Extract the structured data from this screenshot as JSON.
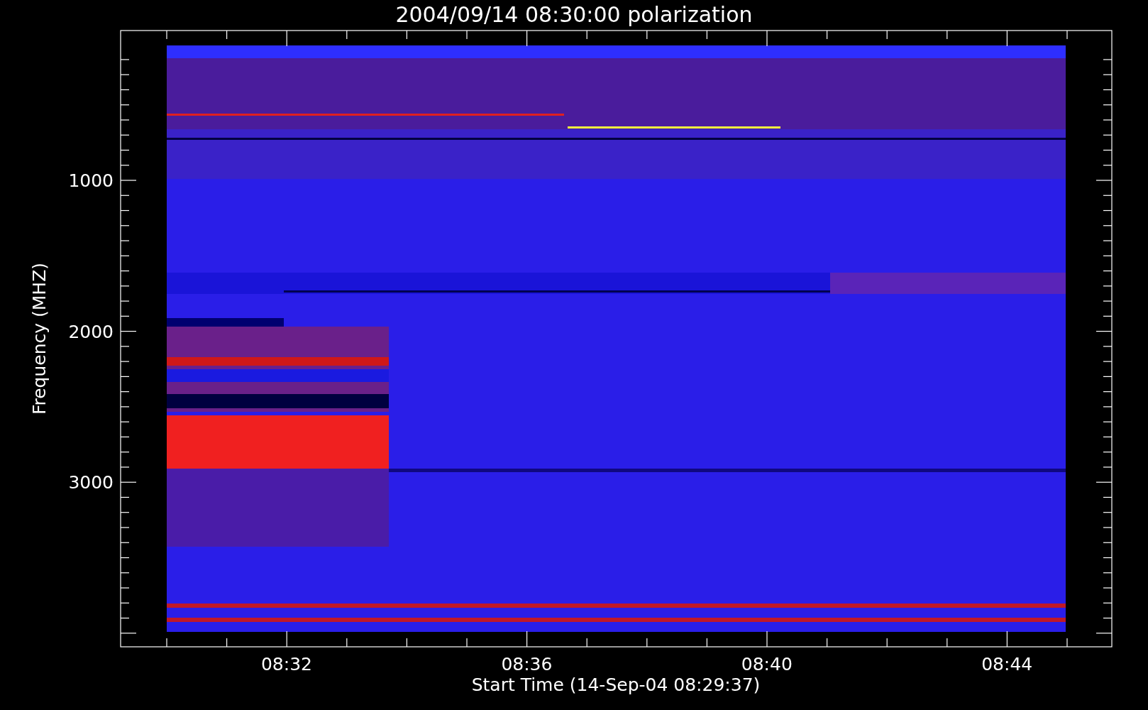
{
  "title": "2004/09/14 08:30:00 polarization",
  "y_axis": {
    "label": "Frequency (MHZ)",
    "tick_labels": [
      "1000",
      "2000",
      "3000"
    ]
  },
  "x_axis": {
    "label": "Start Time (14-Sep-04 08:29:37)",
    "tick_labels": [
      "08:32",
      "08:36",
      "08:40",
      "08:44"
    ]
  }
}
